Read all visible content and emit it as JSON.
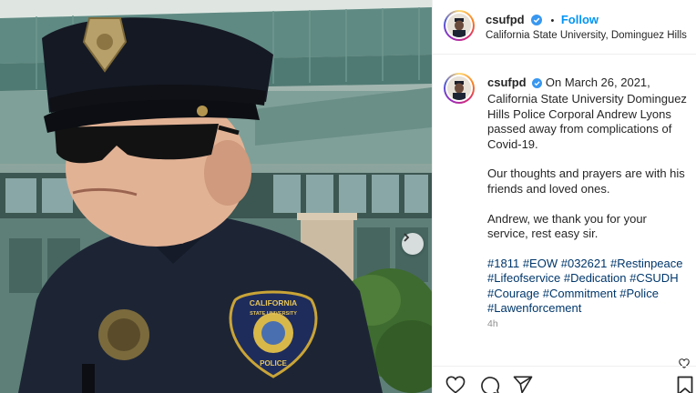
{
  "post": {
    "username": "csufpd",
    "follow_label": "Follow",
    "separator": "•",
    "location": "California State University, Dominguez Hills",
    "caption_paragraphs": [
      "On March 26, 2021, California State University Dominguez Hills Police Corporal Andrew Lyons passed away from complications of Covid-19.",
      "Our thoughts and prayers are with his friends and loved ones.",
      "Andrew, we thank you for your service, rest easy sir."
    ],
    "hashtags": [
      "#1811",
      "#EOW",
      "#032621",
      "#Restinpeace",
      "#Lifeofservice",
      "#Dedication",
      "#CSUDH",
      "#Courage",
      "#Commitment",
      "#Police",
      "#Lawenforcement"
    ],
    "time": "4h",
    "patch_text_top": "CALIFORNIA",
    "patch_text_mid": "STATE UNIVERSITY",
    "patch_text_bottom": "POLICE"
  },
  "icons": {
    "verified": "verified-badge-icon",
    "next": "chevron-right-icon",
    "like": "heart-icon",
    "comment": "comment-icon",
    "share": "send-icon",
    "save": "bookmark-icon"
  },
  "colors": {
    "follow": "#0095f6",
    "hashtag": "#00376b",
    "verified": "#3897f0",
    "muted": "#8e8e8e"
  }
}
